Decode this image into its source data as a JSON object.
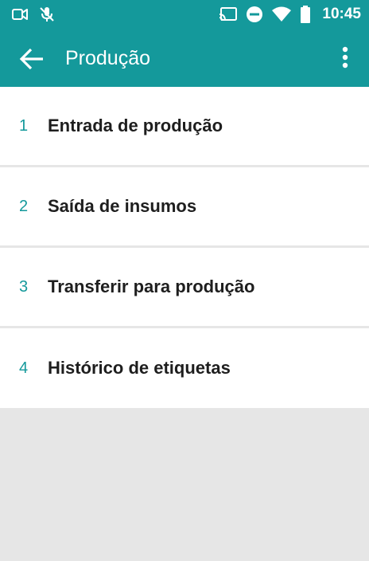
{
  "status_bar": {
    "time": "10:45",
    "icons": [
      "video-camera-icon",
      "mic-off-icon",
      "cast-icon",
      "do-not-disturb-icon",
      "wifi-icon",
      "battery-icon"
    ]
  },
  "app_bar": {
    "title": "Produção",
    "back_icon": "arrow-back-icon",
    "menu_icon": "more-vertical-icon"
  },
  "menu": {
    "items": [
      {
        "number": "1",
        "label": "Entrada de produção"
      },
      {
        "number": "2",
        "label": "Saída de insumos"
      },
      {
        "number": "3",
        "label": "Transferir para produção"
      },
      {
        "number": "4",
        "label": "Histórico de etiquetas"
      }
    ]
  },
  "colors": {
    "primary": "#14999b",
    "item_text": "#1e1e1e",
    "background": "#e6e6e6"
  }
}
